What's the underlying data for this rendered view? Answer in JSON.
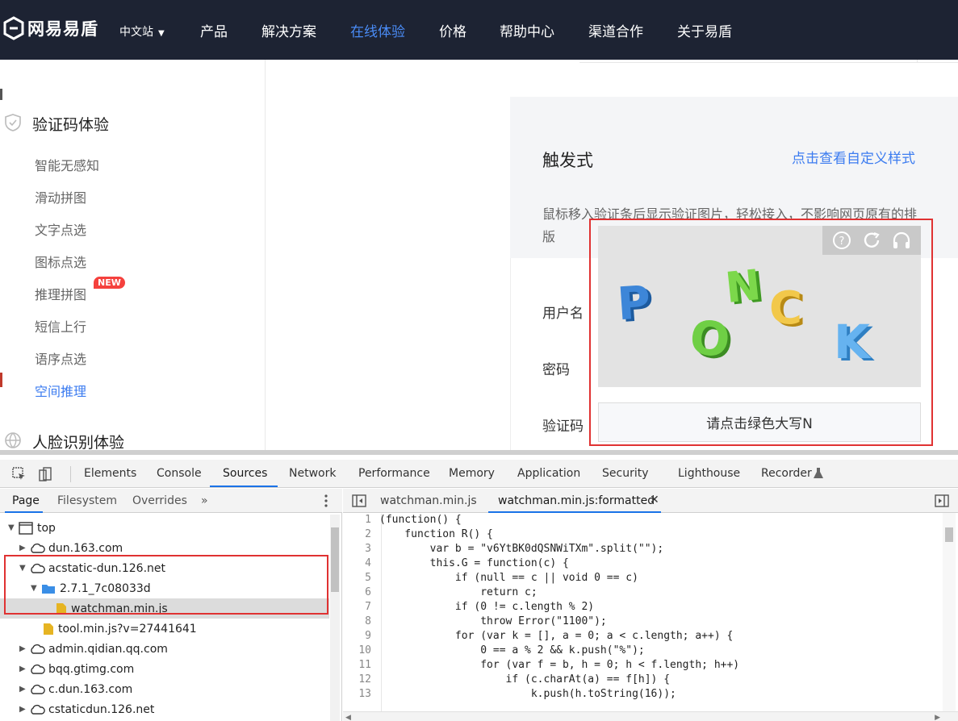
{
  "nav": {
    "logo_text": "网易易盾",
    "language": "中文站",
    "items": [
      "产品",
      "解决方案",
      "在线体验",
      "价格",
      "帮助中心",
      "渠道合作",
      "关于易盾"
    ],
    "active_index": 2
  },
  "sidebar": {
    "section1": "验证码体验",
    "items": [
      "智能无感知",
      "滑动拼图",
      "文字点选",
      "图标点选",
      "推理拼图",
      "短信上行",
      "语序点选",
      "空间推理"
    ],
    "active_index": 7,
    "badge": "NEW",
    "section2": "人脸识别体验"
  },
  "panel": {
    "title": "触发式",
    "link": "点击查看自定义样式",
    "description": "鼠标移入验证条后显示验证图片，轻松接入，不影响网页原有的排版",
    "labels": {
      "username": "用户名",
      "password": "密码",
      "captcha": "验证码"
    },
    "captcha_letters": [
      "P",
      "O",
      "N",
      "C",
      "K"
    ],
    "captcha_prompt": "请点击绿色大写N",
    "tool_icons": [
      "help-icon",
      "refresh-icon",
      "audio-icon"
    ]
  },
  "devtools": {
    "tabs": [
      "Elements",
      "Console",
      "Sources",
      "Network",
      "Performance",
      "Memory",
      "Application",
      "Security",
      "Lighthouse",
      "Recorder"
    ],
    "active_tab": "Sources",
    "nav_tabs": [
      "Page",
      "Filesystem",
      "Overrides",
      "»"
    ],
    "tree": [
      {
        "label": "top",
        "depth": 0,
        "icon": "frame",
        "open": true
      },
      {
        "label": "dun.163.com",
        "depth": 1,
        "icon": "cloud",
        "open": false
      },
      {
        "label": "acstatic-dun.126.net",
        "depth": 1,
        "icon": "cloud",
        "open": true
      },
      {
        "label": "2.7.1_7c08033d",
        "depth": 2,
        "icon": "folder",
        "open": true
      },
      {
        "label": "watchman.min.js",
        "depth": 3,
        "icon": "file",
        "selected": true
      },
      {
        "label": "tool.min.js?v=27441641",
        "depth": 2,
        "icon": "file"
      },
      {
        "label": "admin.qidian.qq.com",
        "depth": 1,
        "icon": "cloud",
        "open": false
      },
      {
        "label": "bqq.gtimg.com",
        "depth": 1,
        "icon": "cloud",
        "open": false
      },
      {
        "label": "c.dun.163.com",
        "depth": 1,
        "icon": "cloud",
        "open": false
      },
      {
        "label": "cstaticdun.126.net",
        "depth": 1,
        "icon": "cloud",
        "open": false
      }
    ],
    "editor_tabs": [
      "watchman.min.js",
      "watchman.min.js:formatted"
    ],
    "code": [
      "(function() {",
      "    function R() {",
      "        var b = \"v6YtBK0dQSNWiTXm\".split(\"\");",
      "        this.G = function(c) {",
      "            if (null == c || void 0 == c)",
      "                return c;",
      "            if (0 != c.length % 2)",
      "                throw Error(\"1100\");",
      "            for (var k = [], a = 0; a < c.length; a++) {",
      "                0 == a % 2 && k.push(\"%\");",
      "                for (var f = b, h = 0; h < f.length; h++)",
      "                    if (c.charAt(a) == f[h]) {",
      "                        k.push(h.toString(16));"
    ]
  }
}
